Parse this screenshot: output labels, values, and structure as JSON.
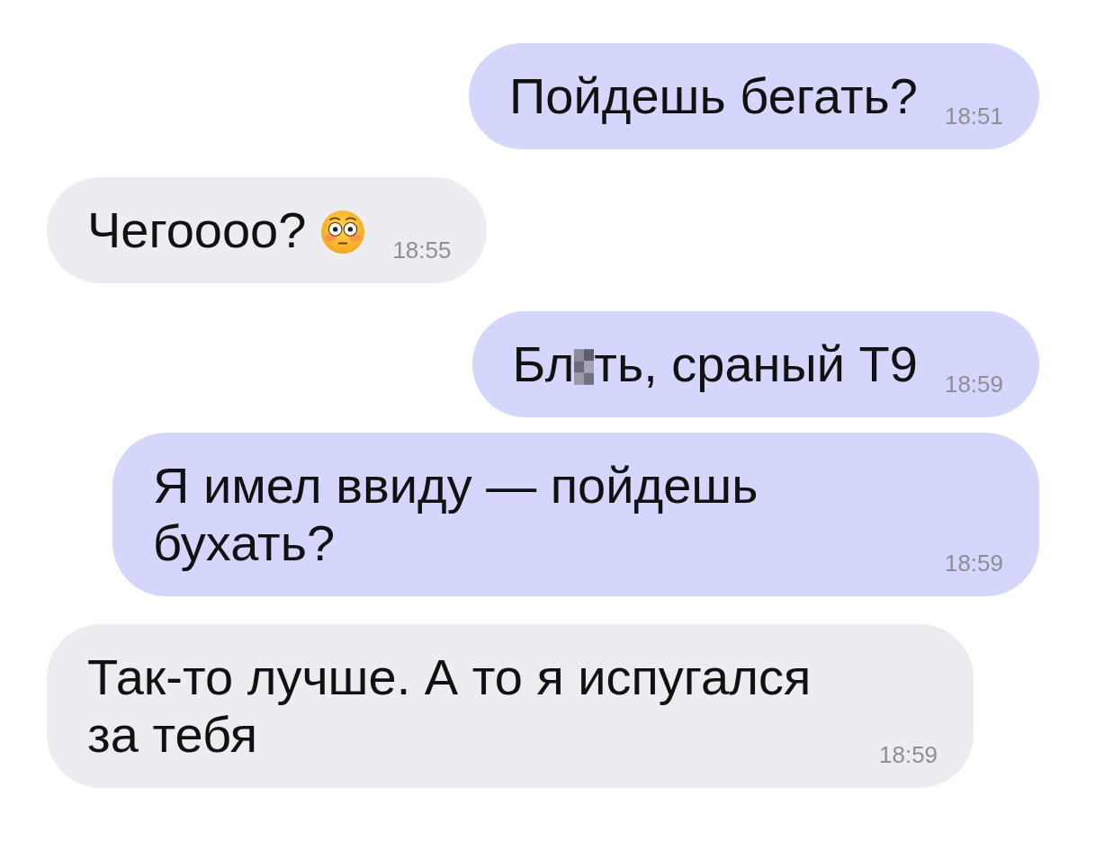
{
  "messages": [
    {
      "kind": "sent",
      "parts": [
        {
          "kind": "text",
          "text": "Пойдешь бегать?"
        }
      ],
      "time": "18:51"
    },
    {
      "kind": "received",
      "parts": [
        {
          "kind": "text",
          "text": "Чегоооо?"
        },
        {
          "kind": "emoji"
        }
      ],
      "time": "18:55"
    },
    {
      "kind": "sent",
      "parts": [
        {
          "kind": "text",
          "text": "Бл"
        },
        {
          "kind": "censored"
        },
        {
          "kind": "text",
          "text": "ть, сраный Т9"
        }
      ],
      "time": "18:59"
    },
    {
      "kind": "sent",
      "parts": [
        {
          "kind": "text",
          "text": "Я имел ввиду — пойдешь бухать?"
        }
      ],
      "time": "18:59"
    },
    {
      "kind": "received",
      "parts": [
        {
          "kind": "text",
          "text": "Так-то лучше. А то я испугался за тебя"
        }
      ],
      "time": "18:59"
    }
  ]
}
